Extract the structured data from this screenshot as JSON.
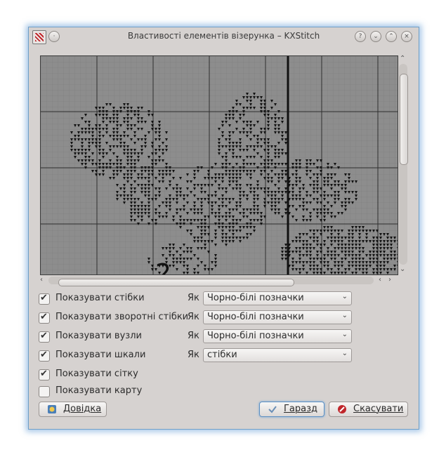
{
  "window": {
    "title": "Властивості елементів візерунка – KXStitch",
    "title_buttons": [
      "help-icon",
      "minimize-icon",
      "maximize-icon",
      "close-icon"
    ]
  },
  "options": [
    {
      "label": "Показувати стібки",
      "checked": true,
      "how_label": "Як",
      "combo_value": "Чорно-білі позначки"
    },
    {
      "label": "Показувати зворотні стібки",
      "checked": true,
      "how_label": "Як",
      "combo_value": "Чорно-білі позначки"
    },
    {
      "label": "Показувати вузли",
      "checked": true,
      "how_label": "Як",
      "combo_value": "Чорно-білі позначки"
    },
    {
      "label": "Показувати шкали",
      "checked": true,
      "how_label": "Як",
      "combo_value": "стібки"
    },
    {
      "label": "Показувати сітку",
      "checked": true
    },
    {
      "label": "Показувати карту",
      "checked": false
    }
  ],
  "buttons": {
    "help": "Довідка",
    "ok": "Гаразд",
    "cancel": "Скасувати"
  },
  "colors": {
    "canvas_bg": "#8d8d8d",
    "accent": "#5c8fc2",
    "cancel_icon": "#c0262b"
  }
}
